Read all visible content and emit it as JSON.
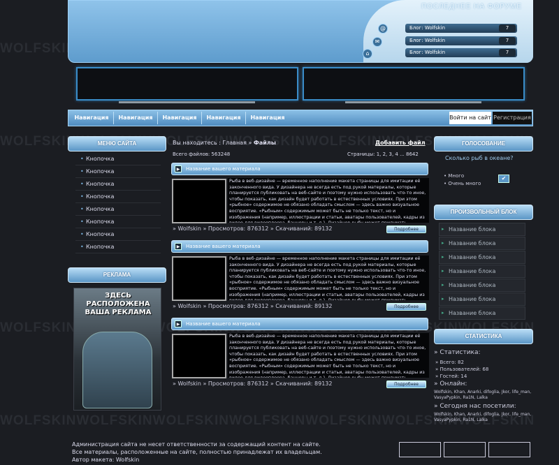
{
  "watermark": "WOLFSKINWOLFSKINWOLFSKINWOLFSKINWOLFSKINWOLFSKINWOLFSKIN",
  "header": {
    "forum_title": "ПОСЛЕДНЕЕ НА ФОРУМЕ",
    "forum_posts": [
      {
        "label": "Блог: Wolfskin",
        "count": "7"
      },
      {
        "label": "Блог: Wolfskin",
        "count": "7"
      },
      {
        "label": "Блог: Wolfskin",
        "count": "7"
      }
    ]
  },
  "nav": {
    "items": [
      "Навигация",
      "Навигация",
      "Навигация",
      "Навигация",
      "Навигация"
    ],
    "login": "Войти на сайт",
    "register": "Регистрация"
  },
  "left": {
    "menu_title": "МЕНЮ САЙТА",
    "menu_items": [
      "Кнопочка",
      "Кнопочка",
      "Кнопочка",
      "Кнопочка",
      "Кнопочка",
      "Кнопочка",
      "Кнопочка",
      "Кнопочка"
    ],
    "ad_title": "РЕКЛАМА",
    "ad_text": "ЗДЕСЬ РАСПОЛОЖЕНА ВАША РЕКЛАМА"
  },
  "center": {
    "breadcrumb_prefix": "Вы находитесь :",
    "breadcrumb_home": "Главная",
    "breadcrumb_sep": "»",
    "breadcrumb_current": "Файлы",
    "add_file": "Добавить файл",
    "total_files": "Всего файлов: 563248",
    "pages": "Страницы: 1, 2, 3, 4 ... 8642",
    "articles": [
      {
        "title": "Название вашего материала",
        "text": "Рыба в веб-дизайне — временное наполнение макета страницы для имитации её законченного вида. У дизайнера не всегда есть под рукой материалы, которые планируется публиковать на веб-сайте и поэтому нужно использовать что-то иное, чтобы показать, как дизайн будет работать в естественных условиях. При этом «рыбное» содержимое не обязано обладать смыслом — здесь важно визуальное восприятие. «Рыбным» содержимым может быть не только текст, но и изображения (например, иллюстрации и статьи, аватары пользователей, кадры из видео для видеоплеера, баннеры и т. д.). Дизайнер рыбу может придумать самостоятельно, а может скопировать с другого аналогичного сайта",
        "meta": "» Wolfskin » Просмотров: 876312 » Скачиваний: 89132",
        "more": "Подробнее"
      },
      {
        "title": "Название вашего материала",
        "text": "Рыба в веб-дизайне — временное наполнение макета страницы для имитации её законченного вида. У дизайнера не всегда есть под рукой материалы, которые планируется публиковать на веб-сайте и поэтому нужно использовать что-то иное, чтобы показать, как дизайн будет работать в естественных условиях. При этом «рыбное» содержимое не обязано обладать смыслом — здесь важно визуальное восприятие. «Рыбным» содержимым может быть не только текст, но и изображения (например, иллюстрации и статьи, аватары пользователей, кадры из видео для видеоплеера, баннеры и т. д.). Дизайнер рыбу может придумать самостоятельно, а может скопировать с другого аналогичного сайта",
        "meta": "» Wolfskin » Просмотров: 876312 » Скачиваний: 89132",
        "more": "Подробнее"
      },
      {
        "title": "Название вашего материала",
        "text": "Рыба в веб-дизайне — временное наполнение макета страницы для имитации её законченного вида. У дизайнера не всегда есть под рукой материалы, которые планируется публиковать на веб-сайте и поэтому нужно использовать что-то иное, чтобы показать, как дизайн будет работать в естественных условиях. При этом «рыбное» содержимое не обязано обладать смыслом — здесь важно визуальное восприятие. «Рыбным» содержимым может быть не только текст, но и изображения (например, иллюстрации и статьи, аватары пользователей, кадры из видео для видеоплеера, баннеры и т. д.). Дизайнер рыбу может придумать самостоятельно, а может скопировать с другого аналогичного сайта",
        "meta": "» Wolfskin » Просмотров: 876312 » Скачиваний: 89132",
        "more": "Подробнее"
      }
    ]
  },
  "right": {
    "poll_title": "ГОЛОСОВАНИЕ",
    "poll_question": "Сколько рыб в океане?",
    "poll_options": [
      "Много",
      "Очень много"
    ],
    "poll_submit_icon": "checkmark-icon",
    "block_title": "ПРОИЗВОЛЬНЫЙ БЛОК",
    "block_items": [
      "Название блока",
      "Название блока",
      "Название блока",
      "Название блока",
      "Название блока",
      "Название блока",
      "Название блока"
    ],
    "stats_title": "СТАТИСТИКА",
    "stats_heading": "» Статистика:",
    "stats_all": "» Всего: 82",
    "stats_users": "» Пользователей: 68",
    "stats_guests": "» Гостей: 14",
    "online_heading": "» Онлайн:",
    "online_users": "Wolfskin, Khan, Anarki, difoglia, Jkor, life_man, VasyaPypkin, Ra1N, Lalka",
    "today_heading": "» Сегодня нас посетили:",
    "today_users": "Wolfskin, Khan, Anarki, difoglia, Jkor, life_man, VasyaPypkin, Ra1N, Lalka"
  },
  "footer": {
    "line1": "Администрация сайта не несет ответственности за содержащий контент на сайте.",
    "line2": "Все материалы, расположенные на сайте, полностью принадлежат их владельцам.",
    "line3": "Автор макета: Wolfskin"
  },
  "colors": {
    "accent": "#5e9ccd",
    "background": "#1b1d22",
    "banner_border": "#3a8cc8"
  }
}
